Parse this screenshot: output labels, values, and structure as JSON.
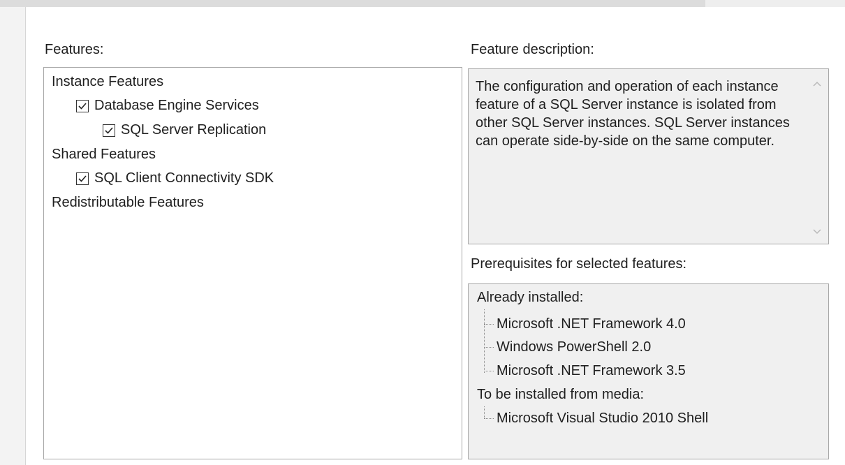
{
  "features": {
    "label": "Features:",
    "tree": {
      "instance_features": "Instance Features",
      "database_engine_services": "Database Engine Services",
      "sql_server_replication": "SQL Server Replication",
      "shared_features": "Shared Features",
      "sql_client_connectivity_sdk": "SQL Client Connectivity SDK",
      "redistributable_features": "Redistributable Features"
    },
    "checked": {
      "database_engine_services": true,
      "sql_server_replication": true,
      "sql_client_connectivity_sdk": true
    }
  },
  "description": {
    "label": "Feature description:",
    "text": "The configuration and operation of each instance feature of a SQL Server instance is isolated from other SQL Server instances. SQL Server instances can operate side-by-side on the same computer."
  },
  "prerequisites": {
    "label": "Prerequisites for selected features:",
    "already_installed_label": "Already installed:",
    "already_installed": [
      "Microsoft .NET Framework 4.0",
      "Windows PowerShell 2.0",
      "Microsoft .NET Framework 3.5"
    ],
    "to_install_label": "To be installed from media:",
    "to_install": [
      "Microsoft Visual Studio 2010 Shell"
    ]
  },
  "icons": {
    "scroll_up": "chevron-up-icon",
    "scroll_down": "chevron-down-icon",
    "checkbox_checked": "checkmark-icon"
  }
}
